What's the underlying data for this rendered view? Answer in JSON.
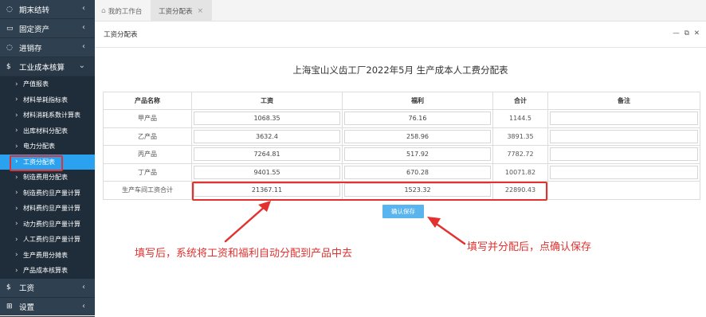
{
  "sidebar": {
    "groups": [
      {
        "label": "期末结转",
        "icon": "circle-icon"
      },
      {
        "label": "固定资产",
        "icon": "monitor-icon"
      },
      {
        "label": "进销存",
        "icon": "circle-icon"
      },
      {
        "label": "工业成本核算",
        "icon": "dollar-icon"
      }
    ],
    "sub_items": [
      "产值报表",
      "材料单耗指标表",
      "材料消耗系数计算表",
      "出库材料分配表",
      "电力分配表",
      "工资分配表",
      "制造费用分配表",
      "制造费约旦产量计算",
      "材料费约旦产量计算",
      "动力费约旦产量计算",
      "人工费约旦产量计算",
      "生产费用分摊表",
      "产品成本核算表"
    ],
    "active_sub": "工资分配表",
    "bottom_groups": [
      {
        "label": "工资",
        "icon": "dollar-icon"
      },
      {
        "label": "设置",
        "icon": "grid-icon"
      }
    ]
  },
  "tabs": {
    "home": "我的工作台",
    "current": "工资分配表"
  },
  "panel": {
    "title": "工资分配表"
  },
  "report": {
    "title": "上海宝山义齿工厂2022年5月 生产成本人工费分配表",
    "headers": [
      "产品名称",
      "工资",
      "福利",
      "合计",
      "备注"
    ],
    "rows": [
      {
        "name": "甲产品",
        "wage": "1068.35",
        "welfare": "76.16",
        "total": "1144.5",
        "note": ""
      },
      {
        "name": "乙产品",
        "wage": "3632.4",
        "welfare": "258.96",
        "total": "3891.35",
        "note": ""
      },
      {
        "name": "丙产品",
        "wage": "7264.81",
        "welfare": "517.92",
        "total": "7782.72",
        "note": ""
      },
      {
        "name": "丁产品",
        "wage": "9401.55",
        "welfare": "670.28",
        "total": "10071.82",
        "note": ""
      }
    ],
    "total_row": {
      "name": "生产车间工资合计",
      "wage": "21367.11",
      "welfare": "1523.32",
      "total": "22890.43"
    },
    "save_label": "确认保存"
  },
  "annotations": {
    "left": "填写后，系统将工资和福利自动分配到产品中去",
    "right": "填写并分配后，点确认保存"
  },
  "colors": {
    "sidebar_bg": "#2f4050",
    "active": "#2aa2f0",
    "annotation": "#e2312f",
    "button": "#5ab5ee"
  }
}
